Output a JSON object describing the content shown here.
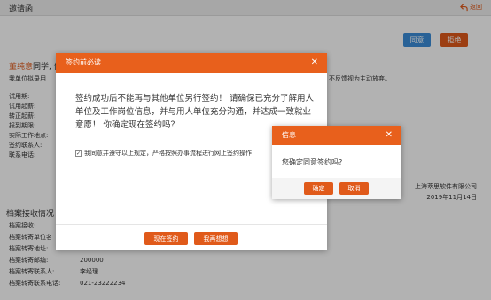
{
  "header": {
    "title": "邀请函",
    "back_label": "返回"
  },
  "actions": {
    "agree_label": "同意",
    "reject_label": "拒绝"
  },
  "letter": {
    "candidate_name": "董纯意",
    "greeting_suffix": "同学, 你",
    "intro_text": "我单位拟录用",
    "notice_tail": "不反馈视为主动放弃。",
    "fields": [
      "试用期:",
      "试用起薪:",
      "转正起薪:",
      "报到期限:",
      "实际工作地点:",
      "签约联系人:",
      "联系电话:"
    ],
    "company": "上海萃思软件有限公司",
    "date": "2019年11月14日"
  },
  "archive": {
    "title": "档案接收情况",
    "rows": [
      {
        "label": "档案接收:",
        "value": ""
      },
      {
        "label": "档案转寄单位名",
        "value": ""
      },
      {
        "label": "档案转寄地址:",
        "value": ""
      },
      {
        "label": "档案转寄邮编:",
        "value": "200000"
      },
      {
        "label": "档案转寄联系人:",
        "value": "李经理"
      },
      {
        "label": "档案转寄联系电话:",
        "value": "021-23222234"
      }
    ]
  },
  "modal_notice": {
    "title": "签约前必读",
    "body": "签约成功后不能再与其他单位另行签约！ 请确保已充分了解用人单位及工作岗位信息，并与用人单位充分沟通，并达成一致就业意愿！ 你确定现在签约吗？",
    "checkbox_label": "我同意并遵守以上规定，严格按照办事流程进行网上签约操作",
    "checkbox_checked": true,
    "sign_now_label": "现在签约",
    "think_again_label": "我再想想",
    "close_glyph": "✕"
  },
  "modal_confirm": {
    "title": "信息",
    "message": "您确定同意签约吗?",
    "ok_label": "确定",
    "cancel_label": "取消",
    "close_glyph": "✕"
  },
  "colors": {
    "accent": "#e8601c",
    "primary": "#3c8dd8"
  }
}
